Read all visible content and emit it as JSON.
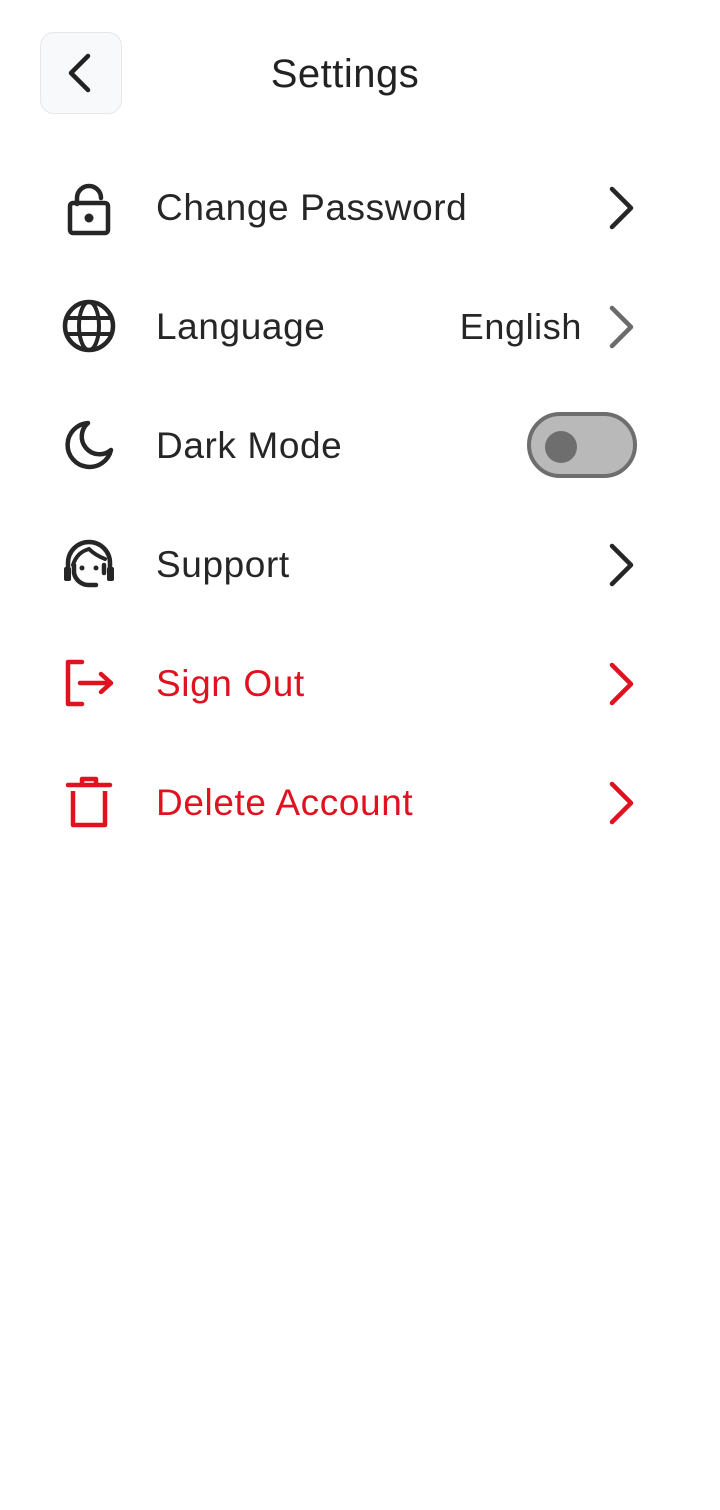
{
  "header": {
    "title": "Settings",
    "back_icon": "chevron-left-icon"
  },
  "colors": {
    "text": "#262626",
    "danger": "#e0121f",
    "toggle_track": "#b9b9b9",
    "toggle_border": "#6e6e6e",
    "back_button_bg": "#f8f9fb"
  },
  "menu": {
    "items": [
      {
        "label": "Change Password",
        "icon": "lock-icon",
        "trailing": "chevron-right-icon"
      },
      {
        "label": "Language",
        "icon": "globe-icon",
        "value": "English",
        "trailing": "chevron-right-icon"
      },
      {
        "label": "Dark Mode",
        "icon": "moon-icon",
        "toggle": false
      },
      {
        "label": "Support",
        "icon": "support-agent-icon",
        "trailing": "chevron-right-icon"
      },
      {
        "label": "Sign Out",
        "icon": "logout-icon",
        "trailing": "chevron-right-icon",
        "danger": true
      },
      {
        "label": "Delete Account",
        "icon": "trash-icon",
        "trailing": "chevron-right-icon",
        "danger": true
      }
    ]
  }
}
